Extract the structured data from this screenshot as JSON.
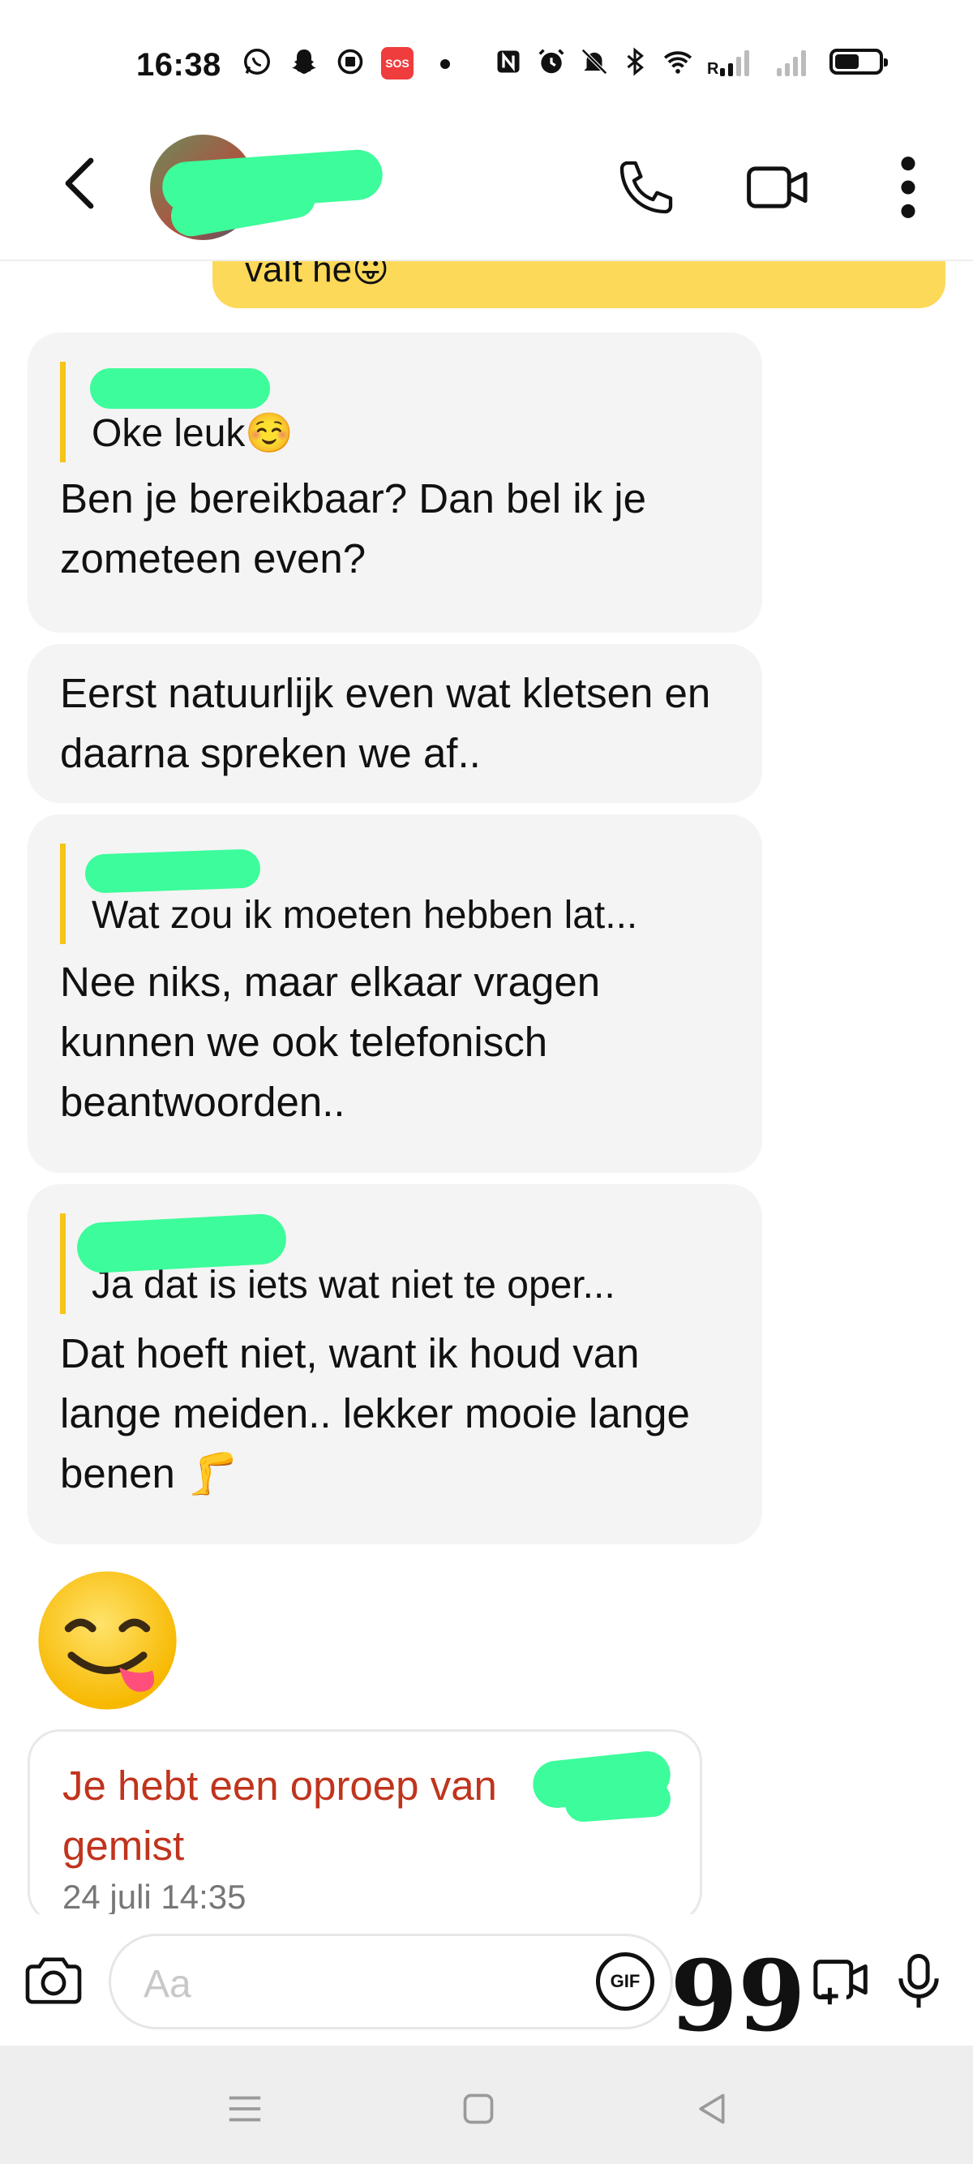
{
  "status_bar": {
    "time": "16:38",
    "sos_label": "SOS",
    "roaming_label": "R",
    "battery_level": 0.55
  },
  "header": {
    "contact_name": "",
    "icons": [
      "back-arrow-icon",
      "phone-icon",
      "video-icon",
      "more-vertical-icon"
    ]
  },
  "messages": {
    "sent_partial": "vaIt he😛",
    "m1": {
      "quote_text": "Oke leuk☺️",
      "text": "Ben je bereikbaar? Dan bel ik je zometeen even?"
    },
    "m2": {
      "text": "Eerst natuurlijk even wat kletsen en daarna spreken we af.."
    },
    "m3": {
      "quote_text": "Wat zou ik moeten hebben lat...",
      "text": "Nee niks, maar elkaar vragen kunnen we ook telefonisch beantwoorden.."
    },
    "m4": {
      "quote_text": "Ja dat is iets wat niet te oper...",
      "text": "Dat hoeft niet, want ik houd van lange meiden.. lekker mooie lange benen 🦵"
    },
    "emoji_message": "😋",
    "missed_call": {
      "text": "Je hebt een oproep van",
      "text_suffix": "gemist",
      "timestamp": "24 juli 14:35"
    }
  },
  "composer": {
    "placeholder": "Aa",
    "gif_label": "GIF",
    "quote_symbol": "99"
  },
  "colors": {
    "sent_bubble": "#fdd959",
    "received_bubble": "#f4f4f4",
    "quote_bar": "#f5c518",
    "missed_call_text": "#c0341d",
    "redaction": "#3dfc9b"
  }
}
